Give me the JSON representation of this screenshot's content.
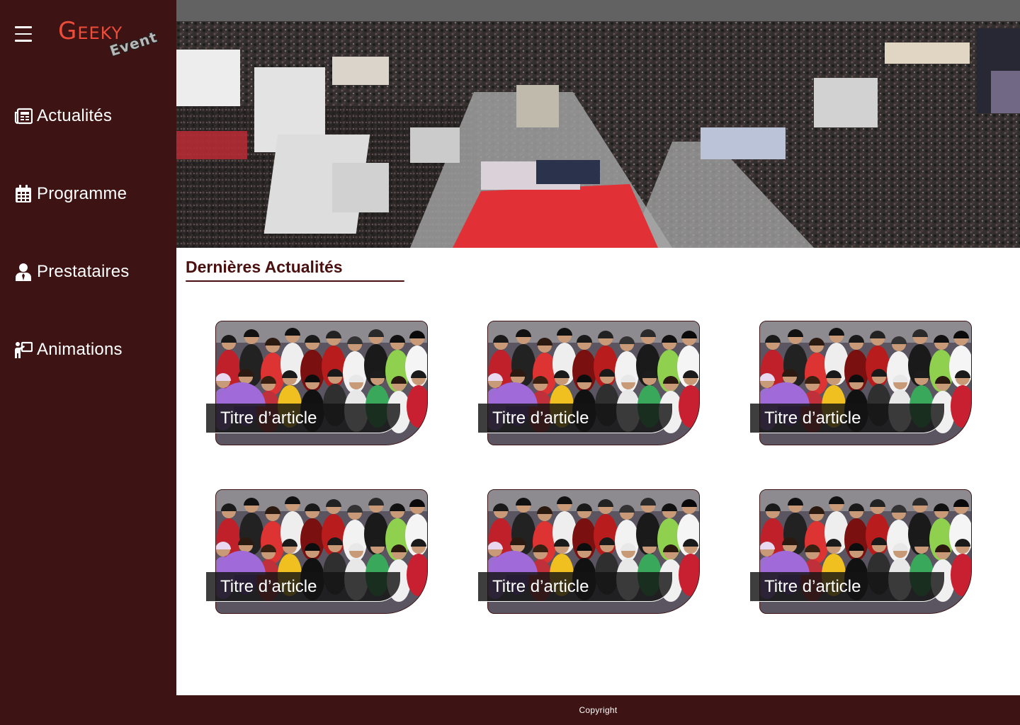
{
  "brand": {
    "logo_main": "Geeky",
    "logo_sub": "Event",
    "accent_color": "#ec4d3b",
    "sidebar_color": "#3d1313"
  },
  "menu": {
    "icon": "hamburger-icon"
  },
  "sidebar": {
    "items": [
      {
        "label": "Actualités",
        "icon": "newspaper-icon"
      },
      {
        "label": "Programme",
        "icon": "calendar-icon"
      },
      {
        "label": "Prestataires",
        "icon": "user-tie-icon"
      },
      {
        "label": "Animations",
        "icon": "presentation-icon"
      }
    ]
  },
  "hero": {
    "image": "convention-hall-crowd-photo"
  },
  "main": {
    "section_title": "Dernières Actualités",
    "articles": [
      {
        "title": "Titre d’article",
        "image": "cosplay-group-photo"
      },
      {
        "title": "Titre d’article",
        "image": "cosplay-group-photo"
      },
      {
        "title": "Titre d’article",
        "image": "cosplay-group-photo"
      },
      {
        "title": "Titre d’article",
        "image": "cosplay-group-photo"
      },
      {
        "title": "Titre d’article",
        "image": "cosplay-group-photo"
      },
      {
        "title": "Titre d’article",
        "image": "cosplay-group-photo"
      }
    ]
  },
  "footer": {
    "text": "Copyright"
  }
}
